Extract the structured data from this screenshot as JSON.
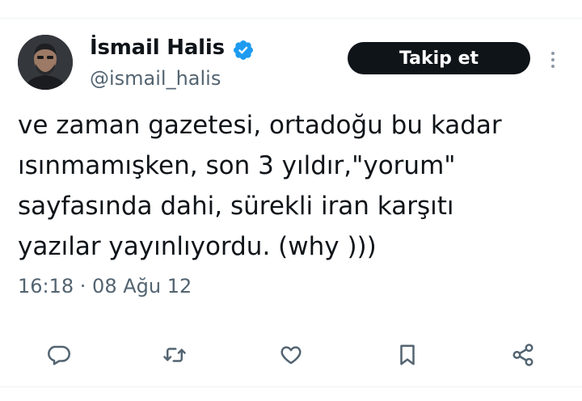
{
  "user": {
    "display_name": "İsmail Halis",
    "handle": "@ismail_halis",
    "verified": true
  },
  "follow_label": "Takip et",
  "tweet": {
    "lines": [
      "ve zaman gazetesi, ortadoğu bu kadar",
      "ısınmamışken, son 3 yıldır,\"yorum\"",
      "sayfasında dahi, sürekli iran karşıtı",
      "yazılar yayınlıyordu. (why )))"
    ],
    "timestamp": "16:18 · 08 Ağu 12"
  },
  "actions": [
    "reply-icon",
    "retweet-icon",
    "like-icon",
    "bookmark-icon",
    "share-icon"
  ],
  "colors": {
    "text": "#0f1419",
    "secondary": "#536471",
    "verified": "#1d9bf0",
    "button_bg": "#0f1419",
    "button_text": "#ffffff"
  }
}
